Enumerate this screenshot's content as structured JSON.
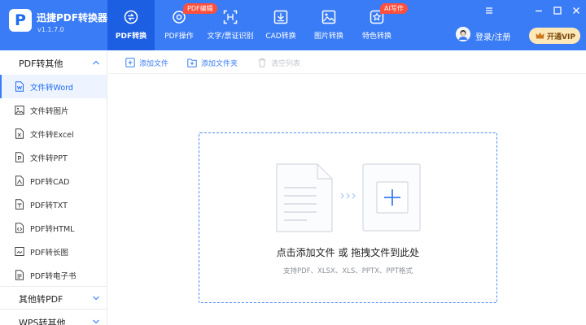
{
  "app": {
    "logo_letter": "P",
    "name": "迅捷PDF转换器",
    "version": "v1.1.7.0"
  },
  "nav": {
    "tabs": [
      {
        "label": "PDF转换",
        "icon": "refresh-document-icon",
        "active": true
      },
      {
        "label": "PDF操作",
        "icon": "gear-document-icon",
        "badge": "PDF编辑"
      },
      {
        "label": "文字/票证识别",
        "icon": "scan-frame-icon"
      },
      {
        "label": "CAD转换",
        "icon": "cad-download-icon"
      },
      {
        "label": "图片转换",
        "icon": "image-icon"
      },
      {
        "label": "特色转换",
        "icon": "star-box-icon",
        "badge": "AI写作"
      }
    ]
  },
  "account": {
    "login_label": "登录/注册",
    "vip_label": "开通VIP"
  },
  "sidebar": {
    "groups": [
      {
        "label": "PDF转其他",
        "expanded": true,
        "items": [
          {
            "label": "文件转Word",
            "icon": "word-icon",
            "active": true
          },
          {
            "label": "文件转图片",
            "icon": "image-icon"
          },
          {
            "label": "文件转Excel",
            "icon": "excel-icon"
          },
          {
            "label": "文件转PPT",
            "icon": "ppt-icon"
          },
          {
            "label": "PDF转CAD",
            "icon": "cad-icon"
          },
          {
            "label": "PDF转TXT",
            "icon": "txt-icon"
          },
          {
            "label": "PDF转HTML",
            "icon": "html-icon"
          },
          {
            "label": "PDF转长图",
            "icon": "long-image-icon"
          },
          {
            "label": "PDF转电子书",
            "icon": "ebook-icon"
          }
        ]
      },
      {
        "label": "其他转PDF",
        "expanded": false
      },
      {
        "label": "WPS转其他",
        "expanded": false
      }
    ]
  },
  "toolbar": {
    "add_file": "添加文件",
    "add_folder": "添加文件夹",
    "clear_list": "清空列表"
  },
  "dropzone": {
    "title": "点击添加文件 或 拖拽文件到此处",
    "subtitle": "支持PDF、XLSX、XLS、PPTX、PPT格式"
  },
  "colors": {
    "brand": "#3a7cf5",
    "header_active": "#1d5fe2",
    "badge": "#ff4f3d",
    "vip_bg": "#ffe8b8"
  }
}
